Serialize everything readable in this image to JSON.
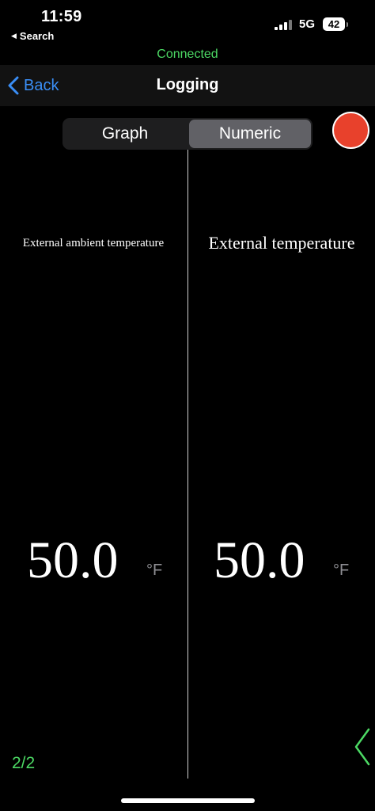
{
  "status_bar": {
    "time": "11:59",
    "back_app": "Search",
    "network": "5G",
    "battery": "42"
  },
  "connection_status": "Connected",
  "nav": {
    "back_label": "Back",
    "title": "Logging"
  },
  "view_switch": {
    "options": [
      "Graph",
      "Numeric"
    ],
    "selected": "Numeric"
  },
  "record_button_color": "#e8412c",
  "panels": [
    {
      "label": "External ambient temperature",
      "value": "50.0",
      "unit": "°F"
    },
    {
      "label": "External temperature",
      "value": "50.0",
      "unit": "°F"
    }
  ],
  "page_indicator": "2/2",
  "colors": {
    "accent_blue": "#3a8ef6",
    "connected_green": "#4cd964"
  },
  "icons": {
    "back": "chevron-left-icon",
    "next_page": "chevron-left-icon"
  }
}
